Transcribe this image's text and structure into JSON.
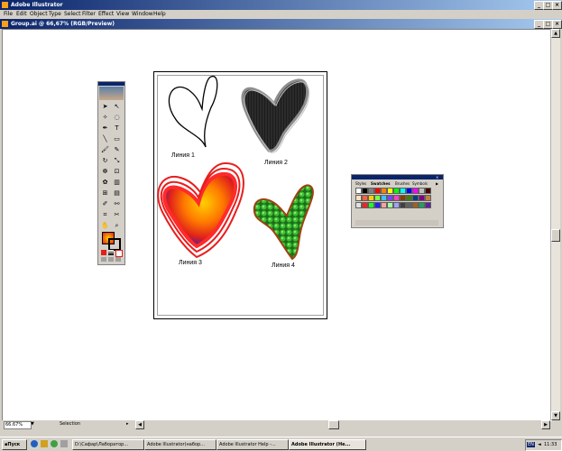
{
  "app": {
    "title": "Adobe Illustrator"
  },
  "menu": [
    "File",
    "Edit",
    "Object",
    "Type",
    "Select",
    "Filter",
    "Effect",
    "View",
    "Window",
    "Help"
  ],
  "document": {
    "title": "Group.ai @ 66,67% (RGB/Preview)"
  },
  "artwork": {
    "labels": [
      "Линия 1",
      "Линия 2",
      "Линия 3",
      "Линия 4"
    ]
  },
  "swatches": {
    "tabs": [
      "Styles",
      "Swatches",
      "Brushes",
      "Symbols"
    ]
  },
  "status": {
    "zoom": "66.67%",
    "tool": "Selection"
  },
  "taskbar": {
    "start": "Пуск",
    "items": [
      "D:\\Сафар\\Лаборатор...",
      "Adobe Illustrator(набор...",
      "Adobe Illustrator Help -...",
      "Adobe Illustrator (Не..."
    ],
    "lang": "EN",
    "clock": "11:33"
  },
  "colors": {
    "accent": "#0a246a",
    "face": "#d4d0c8"
  }
}
